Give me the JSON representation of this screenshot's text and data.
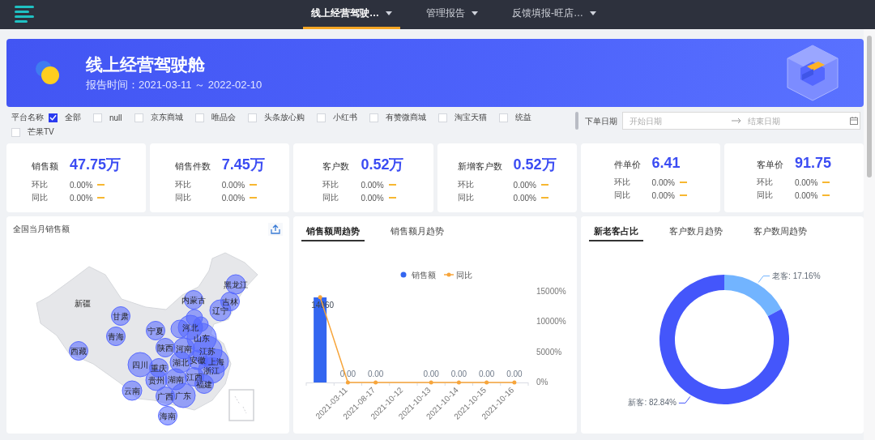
{
  "nav": {
    "tabs": [
      {
        "label": "线上经营驾驶…",
        "selected": true
      },
      {
        "label": "管理报告",
        "selected": false
      },
      {
        "label": "反馈填报-旺店…",
        "selected": false
      }
    ]
  },
  "banner": {
    "title": "线上经营驾驶舱",
    "subtitle": "报告时间：2021-03-11 ～ 2022-02-10"
  },
  "filter": {
    "label": "平台名称",
    "platforms": [
      {
        "label": "全部",
        "checked": true
      },
      {
        "label": "null",
        "checked": false
      },
      {
        "label": "京东商城",
        "checked": false
      },
      {
        "label": "唯品会",
        "checked": false
      },
      {
        "label": "头条放心购",
        "checked": false
      },
      {
        "label": "小红书",
        "checked": false
      },
      {
        "label": "有赞微商城",
        "checked": false
      },
      {
        "label": "淘宝天猫",
        "checked": false
      },
      {
        "label": "统益",
        "checked": false
      },
      {
        "label": "芒果TV",
        "checked": false
      }
    ],
    "date_label": "下单日期",
    "start_placeholder": "开始日期",
    "end_placeholder": "结束日期"
  },
  "kpis": [
    {
      "label": "销售额",
      "value": "47.75万",
      "rows": [
        {
          "label": "环比",
          "value": "0.00%"
        },
        {
          "label": "同比",
          "value": "0.00%"
        }
      ]
    },
    {
      "label": "销售件数",
      "value": "7.45万",
      "rows": [
        {
          "label": "环比",
          "value": "0.00%"
        },
        {
          "label": "同比",
          "value": "0.00%"
        }
      ]
    },
    {
      "label": "客户数",
      "value": "0.52万",
      "rows": [
        {
          "label": "环比",
          "value": "0.00%"
        },
        {
          "label": "同比",
          "value": "0.00%"
        }
      ]
    },
    {
      "label": "新增客户数",
      "value": "0.52万",
      "rows": [
        {
          "label": "环比",
          "value": "0.00%"
        },
        {
          "label": "同比",
          "value": "0.00%"
        }
      ]
    },
    {
      "label": "件单价",
      "value": "6.41",
      "rows": [
        {
          "label": "环比",
          "value": "0.00%"
        },
        {
          "label": "同比",
          "value": "0.00%"
        }
      ]
    },
    {
      "label": "客单价",
      "value": "91.75",
      "rows": [
        {
          "label": "环比",
          "value": "0.00%"
        },
        {
          "label": "同比",
          "value": "0.00%"
        }
      ]
    }
  ],
  "map_panel": {
    "title": "全国当月销售额",
    "provinces": [
      "黑龙江",
      "吉林",
      "辽宁",
      "内蒙古",
      "甘肃",
      "新疆",
      "宁夏",
      "青海",
      "西藏",
      "河北",
      "山东",
      "陕西",
      "河南",
      "江苏",
      "四川",
      "重庆",
      "湖北",
      "安徽",
      "上海",
      "浙江",
      "贵州",
      "湖南",
      "江西",
      "福建",
      "云南",
      "广西",
      "广东",
      "海南"
    ]
  },
  "trend_panel": {
    "tabs": [
      {
        "label": "销售额周趋势",
        "selected": true
      },
      {
        "label": "销售额月趋势",
        "selected": false
      }
    ],
    "chart_data": {
      "type": "bar",
      "categories": [
        null,
        "2021-03-11",
        "2021-08-17",
        "2021-10-12",
        "2021-10-13",
        "2021-10-14",
        "2021-10-15",
        "2021-10-16"
      ],
      "series": [
        {
          "name": "销售额",
          "type": "bar",
          "color": "#3366f0",
          "values": [
            14060,
            0,
            0,
            null,
            0,
            0,
            0,
            0
          ]
        },
        {
          "name": "同比",
          "type": "line",
          "color": "#f7a53b",
          "values": [
            14100,
            0,
            0,
            null,
            0,
            0,
            0,
            0
          ]
        }
      ],
      "legend": "top",
      "ylim": [
        0,
        15000
      ],
      "yticks": [
        {
          "value": 0,
          "label": "0%"
        },
        {
          "value": 5000,
          "label": "5000%"
        },
        {
          "value": 10000,
          "label": "10000%"
        },
        {
          "value": 15000,
          "label": "15000%"
        }
      ],
      "value_labels": [
        "14060",
        "0.00",
        "0.00",
        null,
        "0.00",
        "0.00",
        "0.00",
        "0.00"
      ]
    }
  },
  "customer_panel": {
    "tabs": [
      {
        "label": "新老客占比",
        "selected": true
      },
      {
        "label": "客户数月趋势",
        "selected": false
      },
      {
        "label": "客户数周趋势",
        "selected": false
      }
    ],
    "chart_data": {
      "type": "donut",
      "values": [
        17.16,
        82.84
      ],
      "colors": [
        "#72b4ff",
        "#4456fb"
      ],
      "value_labels": [
        "老客: 17.16%",
        "新客: 82.84%"
      ]
    }
  }
}
